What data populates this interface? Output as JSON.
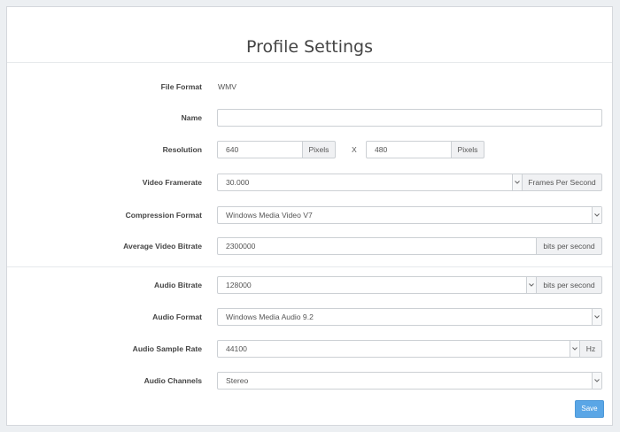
{
  "page": {
    "title": "Profile Settings"
  },
  "fields": {
    "file_format": {
      "label": "File Format",
      "value": "WMV"
    },
    "name": {
      "label": "Name",
      "value": ""
    },
    "resolution": {
      "label": "Resolution",
      "width": "640",
      "height": "480",
      "unit": "Pixels",
      "separator": "X"
    },
    "video_framerate": {
      "label": "Video Framerate",
      "value": "30.000",
      "unit": "Frames Per Second"
    },
    "compression_format": {
      "label": "Compression Format",
      "value": "Windows Media Video V7"
    },
    "avg_video_bitrate": {
      "label": "Average Video Bitrate",
      "value": "2300000",
      "unit": "bits per second"
    },
    "audio_bitrate": {
      "label": "Audio Bitrate",
      "value": "128000",
      "unit": "bits per second"
    },
    "audio_format": {
      "label": "Audio Format",
      "value": "Windows Media Audio 9.2"
    },
    "audio_sample_rate": {
      "label": "Audio Sample Rate",
      "value": "44100",
      "unit": "Hz"
    },
    "audio_channels": {
      "label": "Audio Channels",
      "value": "Stereo"
    }
  },
  "actions": {
    "save_label": "Save"
  },
  "colors": {
    "save_button": "#5aa6e6",
    "background": "#eceff2"
  }
}
